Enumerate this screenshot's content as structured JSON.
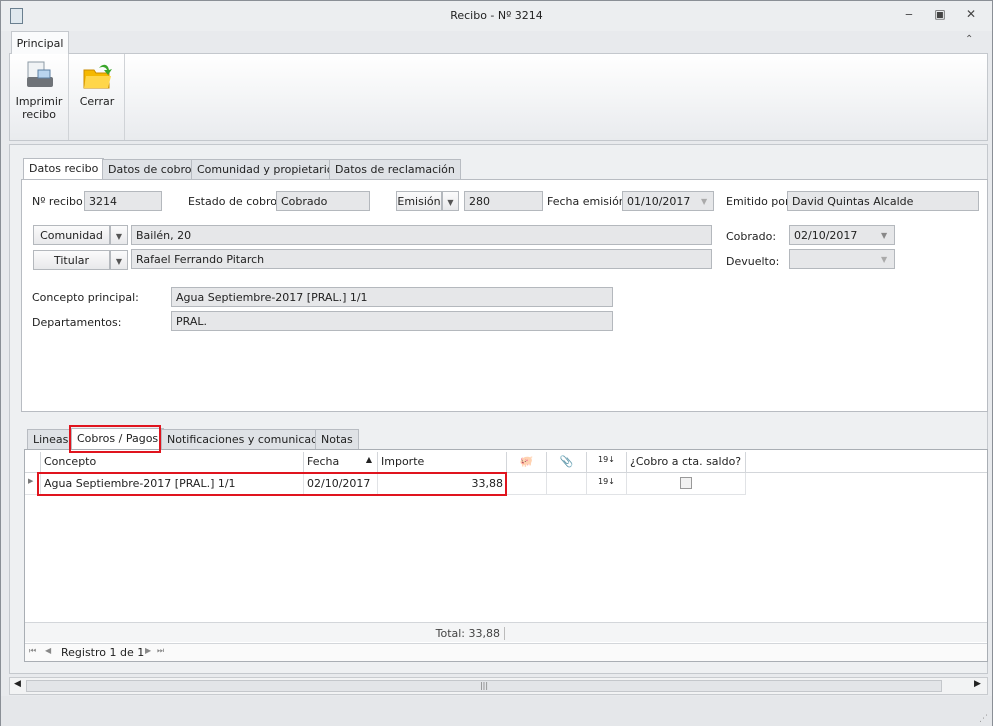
{
  "window": {
    "title": "Recibo - Nº 3214",
    "controls": [
      "minimize",
      "maximize",
      "close"
    ]
  },
  "ribbon": {
    "tab": "Principal",
    "buttons": [
      {
        "label1": "Imprimir",
        "label2": "recibo",
        "icon": "printer-icon"
      },
      {
        "label": "Cerrar",
        "icon": "folder-close-icon"
      }
    ]
  },
  "top_tabs": [
    "Datos recibo",
    "Datos de cobro",
    "Comunidad y propietarios",
    "Datos de reclamación"
  ],
  "form": {
    "num_recibo_label": "Nº recibo:",
    "num_recibo": "3214",
    "estado_label": "Estado de cobro:",
    "estado": "Cobrado",
    "emision_btn": "Emisión",
    "emision": "280",
    "fecha_emision_label": "Fecha emisión:",
    "fecha_emision": "01/10/2017",
    "emitido_label": "Emitido por:",
    "emitido": "David Quintas Alcalde",
    "comunidad_btn": "Comunidad",
    "comunidad": "Bailén, 20",
    "titular_btn": "Titular",
    "titular": "Rafael Ferrando Pitarch",
    "cobrado_label": "Cobrado:",
    "cobrado": "02/10/2017",
    "devuelto_label": "Devuelto:",
    "devuelto": "",
    "concepto_label": "Concepto principal:",
    "concepto": "Agua Septiembre-2017 [PRAL.] 1/1",
    "departamentos_label": "Departamentos:",
    "departamentos": "PRAL."
  },
  "bottom_tabs": [
    "Lineas",
    "Cobros / Pagos",
    "Notificaciones y comunicados",
    "Notas"
  ],
  "grid": {
    "headers": {
      "concepto": "Concepto",
      "fecha": "Fecha",
      "importe": "Importe",
      "cobro": "¿Cobro a cta. saldo?"
    },
    "rows": [
      {
        "concepto": "Agua Septiembre-2017 [PRAL.] 1/1",
        "fecha": "02/10/2017",
        "importe": "33,88",
        "cobro_cta": false
      }
    ],
    "total": "Total: 33,88",
    "nav": "Registro 1 de 1"
  },
  "colors": {
    "highlight": "#e0141e"
  }
}
